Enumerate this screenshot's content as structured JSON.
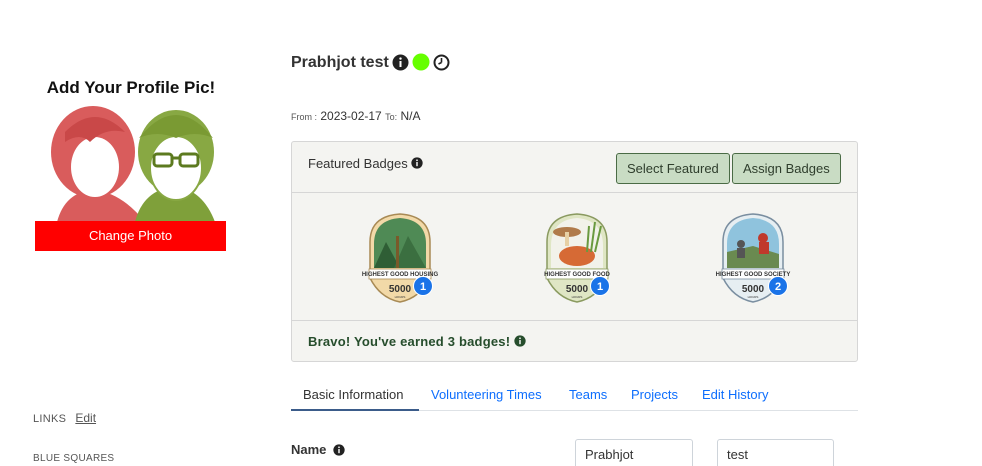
{
  "profile": {
    "picture_caption": "Add Your Profile Pic!",
    "change_photo_label": "Change Photo",
    "links_label": "LINKS",
    "links_edit": "Edit",
    "blue_squares_label": "BLUE SQUARES"
  },
  "header": {
    "user_name": "Prabhjot test",
    "icons": [
      "info-icon",
      "status-green-dot-icon",
      "clock-icon"
    ],
    "status_color": "#66ff00",
    "from_label": "From :",
    "from_date": "2023-02-17",
    "to_label": "To:",
    "to_value": "N/A"
  },
  "badges": {
    "title": "Featured Badges",
    "select_featured_label": "Select Featured",
    "assign_badges_label": "Assign Badges",
    "items": [
      {
        "name": "HIGHEST GOOD HOUSING",
        "hours": "5000",
        "sub": "HOURS",
        "count": "1"
      },
      {
        "name": "HIGHEST GOOD FOOD",
        "hours": "5000",
        "sub": "HOURS",
        "count": "1"
      },
      {
        "name": "HIGHEST GOOD SOCIETY",
        "hours": "5000",
        "sub": "HOURS",
        "count": "2"
      }
    ],
    "footer_text": "Bravo! You've earned 3 badges!",
    "count_color": "#1a73e8"
  },
  "tabs": [
    {
      "label": "Basic Information",
      "active": true
    },
    {
      "label": "Volunteering Times",
      "active": false
    },
    {
      "label": "Teams",
      "active": false
    },
    {
      "label": "Projects",
      "active": false
    },
    {
      "label": "Edit History",
      "active": false
    }
  ],
  "basic_info": {
    "name_label": "Name",
    "first_name": "Prabhjot",
    "last_name": "test"
  }
}
